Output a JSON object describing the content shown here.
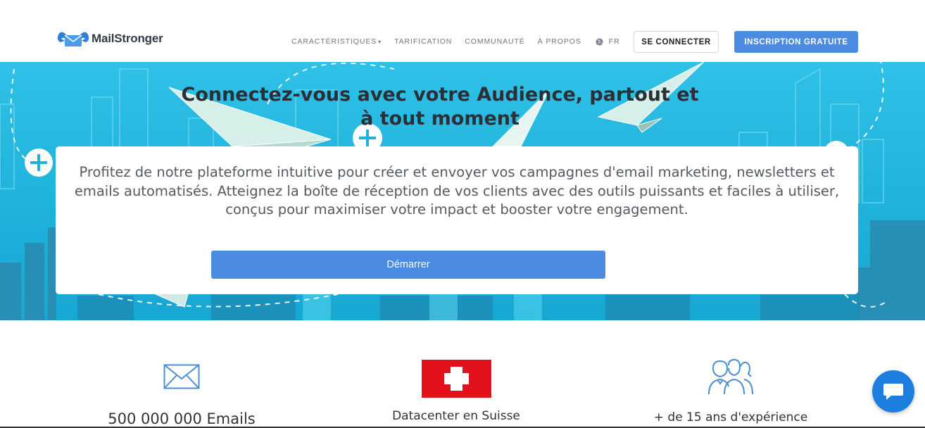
{
  "brand": {
    "name": "MailStronger",
    "logo_icon": "envelope-arms-logo-icon"
  },
  "nav": {
    "items": [
      {
        "label": "CARACTÉRISTIQUES",
        "has_dropdown": true
      },
      {
        "label": "TARIFICATION",
        "has_dropdown": false
      },
      {
        "label": "COMMUNAUTÉ",
        "has_dropdown": false
      },
      {
        "label": "À PROPOS",
        "has_dropdown": false
      }
    ],
    "language": {
      "icon": "globe-icon",
      "value": "FR"
    },
    "login_label": "SE CONNECTER",
    "signup_label": "INSCRIPTION GRATUITE"
  },
  "hero": {
    "subtitle": "Connectez-vous avec votre Audience, partout et à tout moment",
    "description": "Profitez de notre plateforme intuitive pour créer et envoyer vos campagnes d'email marketing, newsletters et emails automatisés. Atteignez la boîte de réception de vos clients avec des outils puissants et faciles à utiliser, conçus pour maximiser votre impact et booster votre engagement.",
    "cta_label": "Démarrer"
  },
  "features": [
    {
      "icon": "envelope-icon",
      "label": "500 000 000 Emails"
    },
    {
      "icon": "swiss-flag-icon",
      "label": "Datacenter en Suisse"
    },
    {
      "icon": "users-icon",
      "label": "+ de 15 ans d'expérience"
    }
  ],
  "chat": {
    "icon": "chat-icon"
  },
  "colors": {
    "accent": "#4b8be0",
    "hero_bg": "#1fb2db",
    "chat": "#1c7fe0",
    "swiss_red": "#e3111b"
  }
}
